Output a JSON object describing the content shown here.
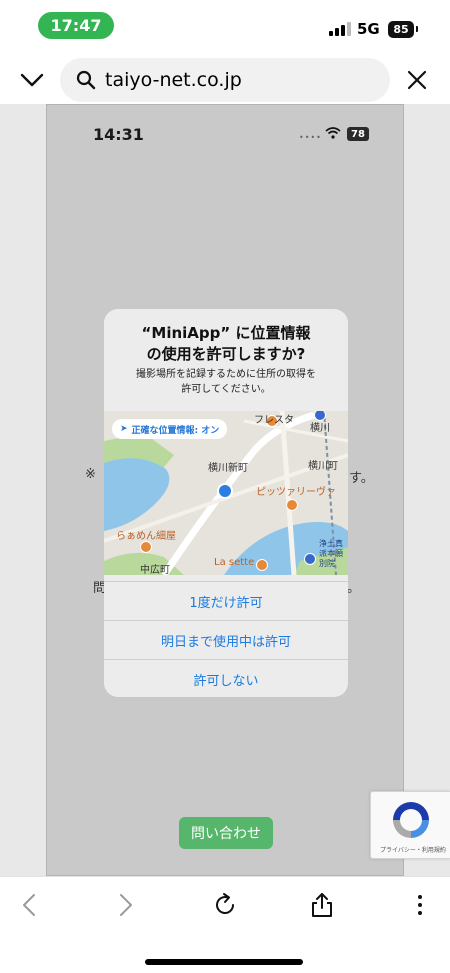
{
  "status_bar": {
    "time": "17:47",
    "network": "5G",
    "battery": "85"
  },
  "browser": {
    "url": "taiyo-net.co.jp"
  },
  "inner_page": {
    "status_time": "14:31",
    "battery": "78",
    "behind_text_1": "※",
    "behind_text_2": "す。",
    "behind_text_3": "問",
    "behind_text_4": "。",
    "contact_button": "問い合わせ"
  },
  "dialog": {
    "title_line1": "“MiniApp” に位置情報",
    "title_line2": "の使用を許可しますか?",
    "message_line1": "撮影場所を記録するために住所の取得を",
    "message_line2": "許可してください。",
    "precise_location": "正確な位置情報: オン",
    "map_labels": {
      "festa": "フレスタ",
      "yokogawa": "横川",
      "yokogawa_shinmachi": "横川新町",
      "yokogawa_cho": "横川町",
      "pizzeria": "ピッツァリーヴァ",
      "ramen": "らぁめん細屋",
      "nakahiro": "中広町",
      "la_sette": "La sette",
      "jodo_1": "浄土真",
      "jodo_2": "派本願",
      "jodo_3": "別院"
    },
    "buttons": {
      "allow_once": "1度だけ許可",
      "allow_while_using": "明日まで使用中は許可",
      "deny": "許可しない"
    }
  },
  "recaptcha": {
    "links": "プライバシー・利用規約"
  },
  "colors": {
    "time_pill": "#34b553",
    "dialog_button_text": "#1a7ae0",
    "contact_button": "#56b66b",
    "user_location": "#2b7fe0"
  }
}
